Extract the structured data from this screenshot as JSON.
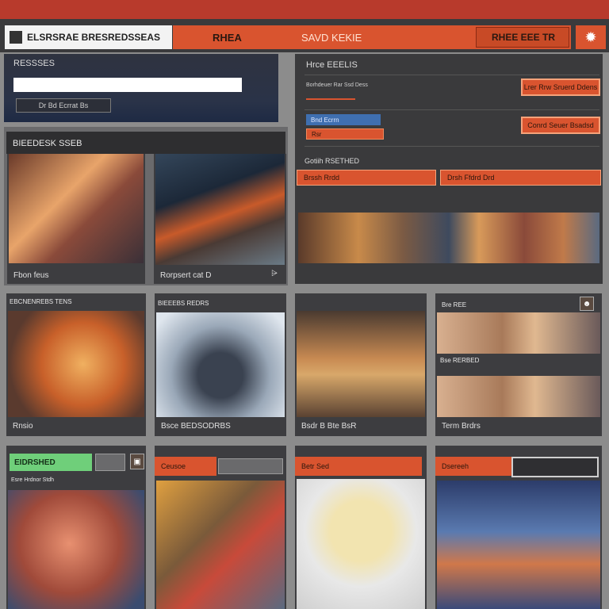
{
  "window": {
    "accent": "#d9542f",
    "title_bar_color": "#b83a2c"
  },
  "tabs": {
    "logo_label": "ELSRSRAE BRESREDSSEAS",
    "items": [
      {
        "label": "RHEA"
      },
      {
        "label": "SAVD  KEKIE"
      },
      {
        "label": "RHEE EEE TR"
      }
    ],
    "settings_icon": "gear-icon"
  },
  "search": {
    "title": "RESSSES",
    "placeholder": "",
    "button_label": "Dr Bd Ecrrat Bs"
  },
  "form": {
    "title": "Hrce EEELIS",
    "row1_text": "Borhdeuer Rar Ssd Dess",
    "row1_button": "Lrer Rrw Sruerd Ddens",
    "row2_blue": "Bnd Ecrrn",
    "row2_orange": "Rsr",
    "row2_button": "Conrd Seuer Bsadsd",
    "section_label": "Gotiih RSETHED",
    "field1": "Brssh Rrdd",
    "field2": "Drsh Ffdrd Drd"
  },
  "gallery": {
    "title": "BIEEDESK  SSEB",
    "cards": [
      {
        "caption": "Fbon feus"
      },
      {
        "caption": "Rorpsert cat D"
      }
    ],
    "share_icon": "share-icon"
  },
  "row2": [
    {
      "header": "EBCNENREBS TENS",
      "caption": "Rnsio"
    },
    {
      "header": "BIEEEBS REDRS",
      "caption": "Bsce BEDSODRBS"
    },
    {
      "header": "",
      "caption": "Bsdr B Bte BsR"
    },
    {
      "header": "Bre REE",
      "middle": "Bse RERBED",
      "caption": "Term Brdrs"
    }
  ],
  "row3": [
    {
      "tag": "EIDRSHED",
      "subtitle": "Esre Hrdnor Stdh"
    },
    {
      "header": "Ceusoe"
    },
    {
      "header": "Betr Sed"
    },
    {
      "header": "Dsereeh"
    }
  ]
}
